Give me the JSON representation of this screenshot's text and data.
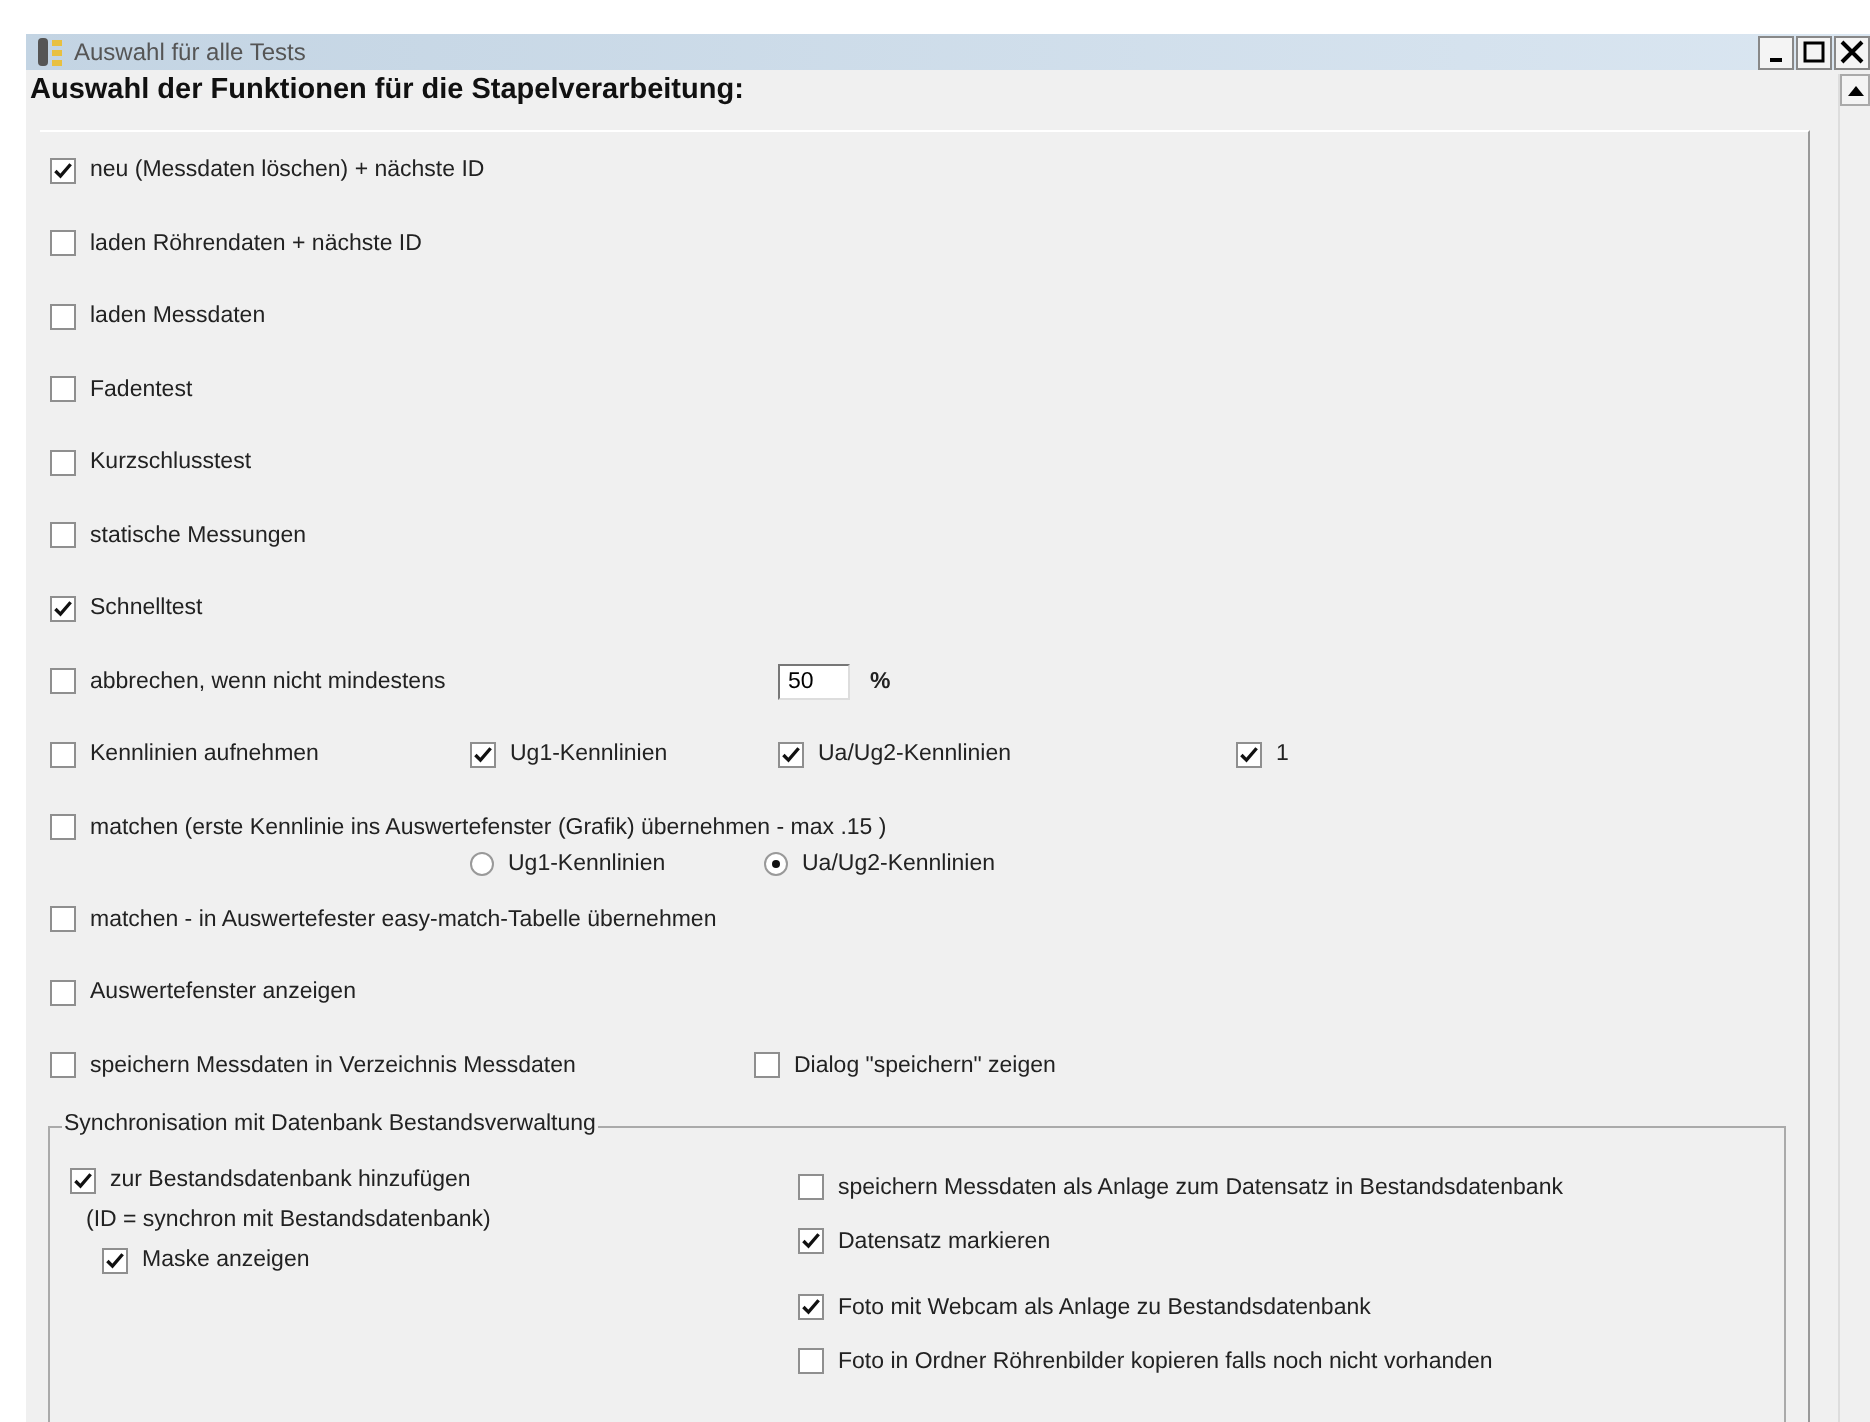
{
  "window": {
    "title": "Auswahl für alle Tests"
  },
  "heading": "Auswahl der Funktionen für die Stapelverarbeitung:",
  "options": [
    {
      "kind": "check",
      "label": "neu (Messdaten löschen) + nächste  ID",
      "checked": true
    },
    {
      "kind": "check",
      "label": "laden Röhrendaten + nächste ID",
      "checked": false
    },
    {
      "kind": "check",
      "label": "laden Messdaten",
      "checked": false
    },
    {
      "kind": "check",
      "label": "Fadentest",
      "checked": false
    },
    {
      "kind": "check",
      "label": "Kurzschlusstest",
      "checked": false
    },
    {
      "kind": "check",
      "label": "statische Messungen",
      "checked": false
    },
    {
      "kind": "check",
      "label": "Schnelltest",
      "checked": true
    },
    {
      "kind": "threshold",
      "label": "abbrechen, wenn nicht mindestens",
      "checked": false,
      "value": "50",
      "unit": "%"
    },
    {
      "kind": "multi",
      "label": "Kennlinien aufnehmen",
      "checked": false,
      "extras": [
        {
          "label": "Ug1-Kennlinien",
          "checked": true
        },
        {
          "label": "Ua/Ug2-Kennlinien",
          "checked": true
        },
        {
          "label": "1",
          "checked": true
        }
      ]
    },
    {
      "kind": "radio",
      "label": "matchen (erste Kennlinie ins Auswertefenster (Grafik) übernehmen -  max .15 )",
      "checked": false,
      "choices": [
        {
          "label": "Ug1-Kennlinien",
          "selected": false
        },
        {
          "label": "Ua/Ug2-Kennlinien",
          "selected": true
        }
      ]
    },
    {
      "kind": "check",
      "label": "matchen - in Auswertefester easy-match-Tabelle  übernehmen",
      "checked": false
    },
    {
      "kind": "check",
      "label": "Auswertefenster anzeigen",
      "checked": false
    },
    {
      "kind": "save",
      "label": "speichern Messdaten in Verzeichnis Messdaten",
      "checked": false,
      "extras": [
        {
          "label": "Dialog \"speichern\" zeigen",
          "checked": false
        }
      ]
    }
  ],
  "sync": {
    "legend": "Synchronisation mit Datenbank Bestandsverwaltung",
    "left": [
      {
        "kind": "check",
        "label": "zur Bestandsdatenbank hinzufügen",
        "checked": true
      },
      {
        "kind": "note",
        "label": "(ID = synchron mit Bestandsdatenbank)"
      },
      {
        "kind": "sub",
        "label": "Maske anzeigen",
        "checked": true
      }
    ],
    "right": [
      {
        "kind": "check",
        "label": "speichern Messdaten als Anlage zum Datensatz in Bestandsdatenbank",
        "checked": false
      },
      {
        "kind": "check",
        "label": "Datensatz markieren",
        "checked": true
      },
      {
        "kind": "gap",
        "label": "Foto mit Webcam als Anlage zu Bestandsdatenbank",
        "checked": true
      },
      {
        "kind": "check",
        "label": "Foto in Ordner Röhrenbilder kopieren falls noch nicht vorhanden",
        "checked": false
      }
    ]
  }
}
